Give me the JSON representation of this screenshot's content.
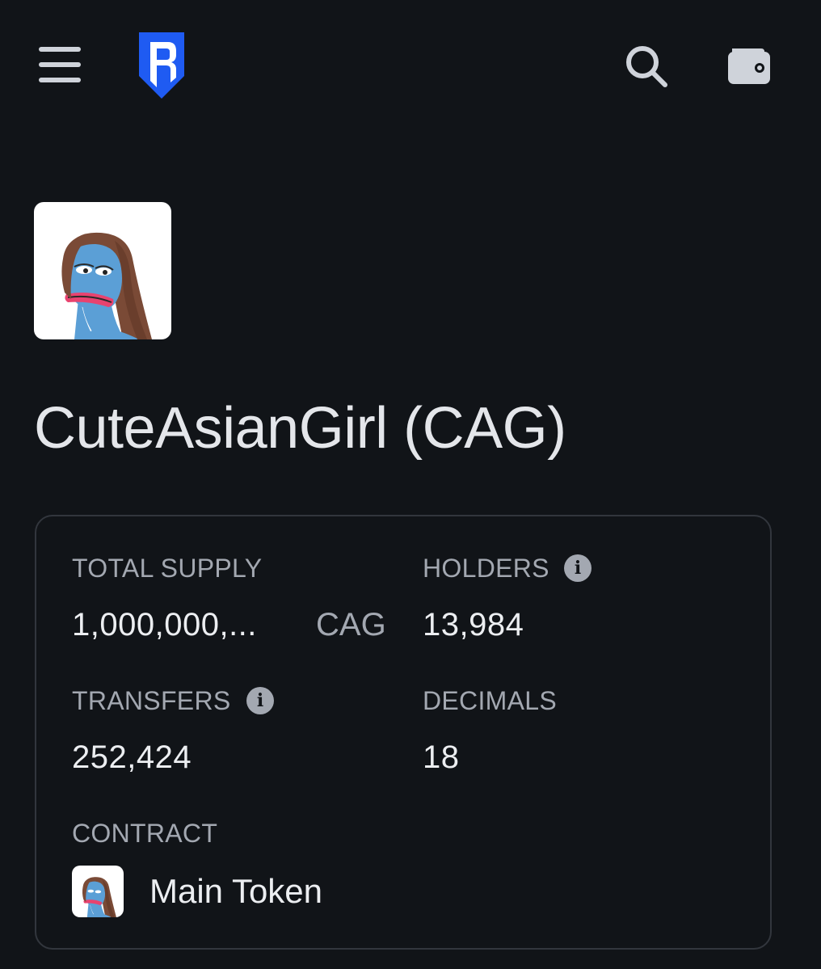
{
  "header": {
    "menu_icon": "hamburger-menu-icon",
    "logo_icon": "ronin-logo-icon",
    "search_icon": "search-icon",
    "wallet_icon": "wallet-icon",
    "brand_color": "#1f5bf2"
  },
  "token": {
    "avatar_icon": "pepe-girl-avatar-icon",
    "title": "CuteAsianGirl (CAG)"
  },
  "stats": {
    "total_supply_label": "TOTAL SUPPLY",
    "total_supply_value": "1,000,000,...",
    "total_supply_unit": "CAG",
    "holders_label": "HOLDERS",
    "holders_value": "13,984",
    "transfers_label": "TRANSFERS",
    "transfers_value": "252,424",
    "decimals_label": "DECIMALS",
    "decimals_value": "18",
    "info_glyph": "i"
  },
  "contract": {
    "label": "CONTRACT",
    "name": "Main Token",
    "avatar_icon": "pepe-girl-avatar-icon"
  }
}
